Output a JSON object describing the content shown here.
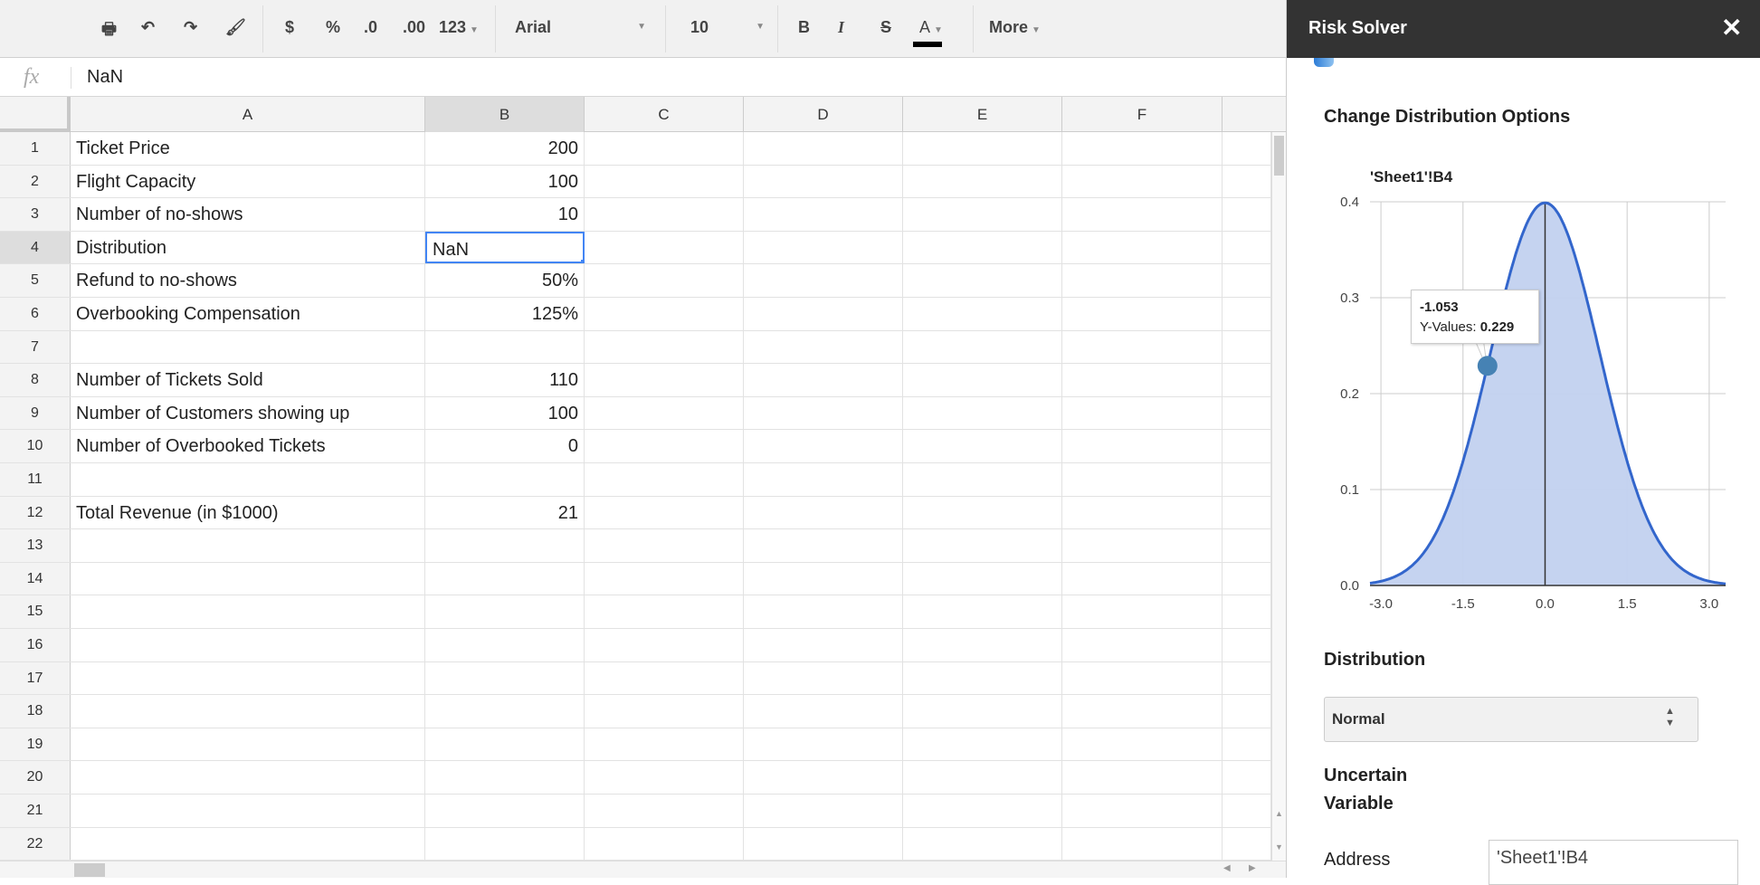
{
  "toolbar": {
    "currency": "$",
    "percent": "%",
    "dec_decrease": ".0",
    "dec_increase": ".00",
    "more_formats": "123",
    "font": "Arial",
    "size": "10",
    "bold": "B",
    "italic": "I",
    "strike": "S",
    "text_color": "A",
    "more": "More",
    "text_color_hex": "#000000"
  },
  "formula_bar": {
    "fx": "fx",
    "value": "NaN"
  },
  "columns": [
    "A",
    "B",
    "C",
    "D",
    "E",
    "F"
  ],
  "selected_cell": "B4",
  "rows": [
    {
      "n": "1",
      "a": "Ticket Price",
      "b": "200"
    },
    {
      "n": "2",
      "a": "Flight Capacity",
      "b": "100"
    },
    {
      "n": "3",
      "a": "Number of no-shows",
      "b": "10"
    },
    {
      "n": "4",
      "a": "Distribution",
      "b": "NaN"
    },
    {
      "n": "5",
      "a": "Refund to no-shows",
      "b": "50%"
    },
    {
      "n": "6",
      "a": "Overbooking Compensation",
      "b": "125%"
    },
    {
      "n": "7",
      "a": "",
      "b": ""
    },
    {
      "n": "8",
      "a": "Number of Tickets Sold",
      "b": "110"
    },
    {
      "n": "9",
      "a": "Number of Customers showing up",
      "b": "100"
    },
    {
      "n": "10",
      "a": "Number of Overbooked Tickets",
      "b": "0"
    },
    {
      "n": "11",
      "a": "",
      "b": ""
    },
    {
      "n": "12",
      "a": "Total Revenue (in $1000)",
      "b": "21"
    },
    {
      "n": "13",
      "a": "",
      "b": ""
    },
    {
      "n": "14",
      "a": "",
      "b": ""
    },
    {
      "n": "15",
      "a": "",
      "b": ""
    },
    {
      "n": "16",
      "a": "",
      "b": ""
    },
    {
      "n": "17",
      "a": "",
      "b": ""
    },
    {
      "n": "18",
      "a": "",
      "b": ""
    },
    {
      "n": "19",
      "a": "",
      "b": ""
    },
    {
      "n": "20",
      "a": "",
      "b": ""
    },
    {
      "n": "21",
      "a": "",
      "b": ""
    },
    {
      "n": "22",
      "a": "",
      "b": ""
    }
  ],
  "panel": {
    "title": "Risk Solver",
    "close": "✕",
    "heading": "Change Distribution Options",
    "distribution_label": "Distribution",
    "distribution_value": "Normal",
    "uncertain_label_1": "Uncertain",
    "uncertain_label_2": "Variable",
    "address_label": "Address",
    "address_value": "'Sheet1'!B4"
  },
  "chart_data": {
    "type": "area",
    "title": "'Sheet1'!B4",
    "distribution": "normal",
    "mean": 0,
    "sd": 1,
    "xlim": [
      -3.2,
      3.3
    ],
    "ylim": [
      0,
      0.4
    ],
    "xticks": [
      "-3.0",
      "-1.5",
      "0.0",
      "1.5",
      "3.0"
    ],
    "yticks": [
      "0.0",
      "0.1",
      "0.2",
      "0.3",
      "0.4"
    ],
    "grid": true,
    "line_color": "#3366cc",
    "fill_color": "#c2d1ef",
    "tooltip": {
      "x": "-1.053",
      "y_label": "Y-Values:",
      "y": "0.229"
    },
    "highlight_point": {
      "x": -1.053,
      "y": 0.229
    }
  }
}
